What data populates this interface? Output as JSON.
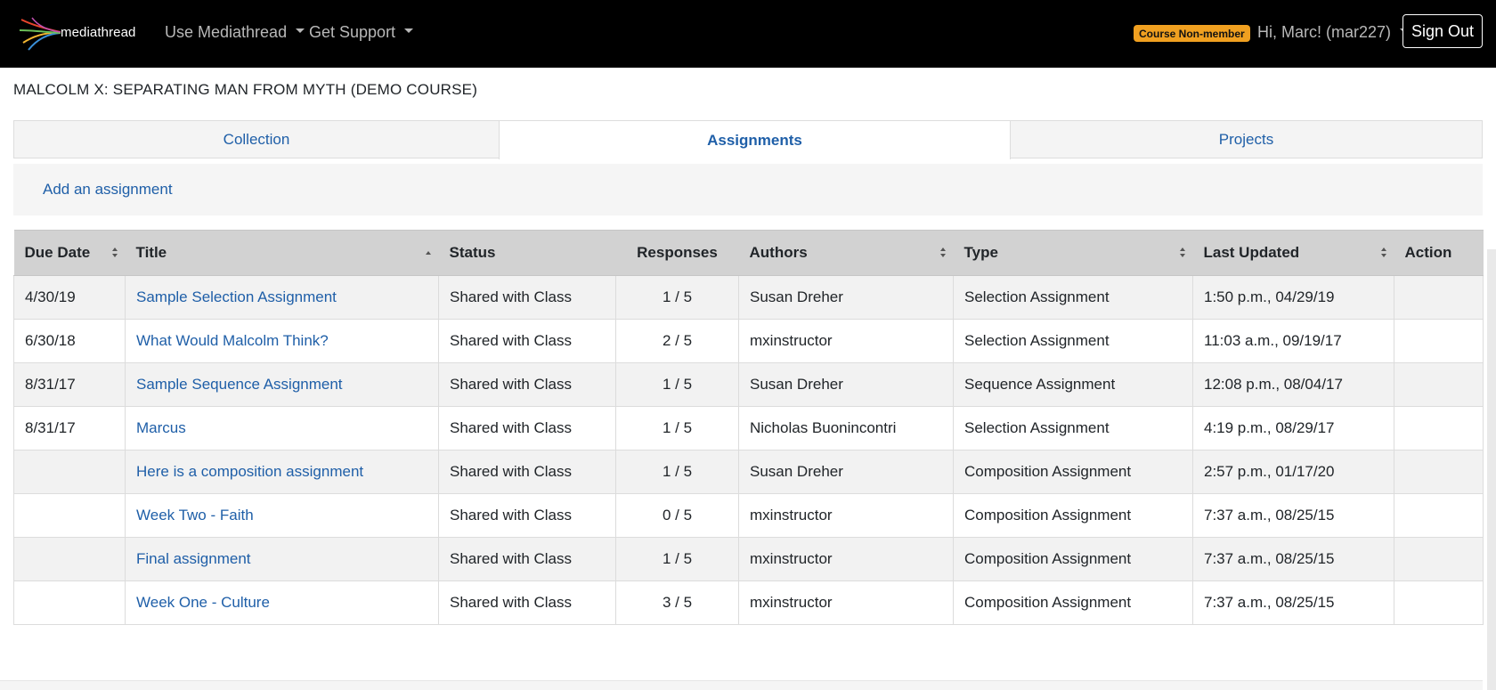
{
  "navbar": {
    "brand": "mediathread",
    "menu_use": "Use Mediathread",
    "menu_support": "Get Support",
    "badge": "Course Non-member",
    "user": "Hi, Marc! (mar227)",
    "sign_out": "Sign Out"
  },
  "course_title": "MALCOLM X: SEPARATING MAN FROM MYTH (DEMO COURSE)",
  "tabs": [
    {
      "label": "Collection"
    },
    {
      "label": "Assignments"
    },
    {
      "label": "Projects"
    }
  ],
  "add_assignment": "Add an assignment",
  "table": {
    "headers": {
      "due_date": "Due Date",
      "title": "Title",
      "status": "Status",
      "responses": "Responses",
      "authors": "Authors",
      "type": "Type",
      "last_updated": "Last Updated",
      "action": "Action"
    },
    "rows": [
      {
        "due": "4/30/19",
        "title": "Sample Selection Assignment",
        "status": "Shared with Class",
        "responses": "1 / 5",
        "author": "Susan Dreher",
        "type": "Selection Assignment",
        "updated": "1:50 p.m., 04/29/19"
      },
      {
        "due": "6/30/18",
        "title": "What Would Malcolm Think?",
        "status": "Shared with Class",
        "responses": "2 / 5",
        "author": "mxinstructor",
        "type": "Selection Assignment",
        "updated": "11:03 a.m., 09/19/17"
      },
      {
        "due": "8/31/17",
        "title": "Sample Sequence Assignment",
        "status": "Shared with Class",
        "responses": "1 / 5",
        "author": "Susan Dreher",
        "type": "Sequence Assignment",
        "updated": "12:08 p.m., 08/04/17"
      },
      {
        "due": "8/31/17",
        "title": "Marcus",
        "status": "Shared with Class",
        "responses": "1 / 5",
        "author": "Nicholas Buonincontri",
        "type": "Selection Assignment",
        "updated": "4:19 p.m., 08/29/17"
      },
      {
        "due": "",
        "title": "Here is a composition assignment",
        "status": "Shared with Class",
        "responses": "1 / 5",
        "author": "Susan Dreher",
        "type": "Composition Assignment",
        "updated": "2:57 p.m., 01/17/20"
      },
      {
        "due": "",
        "title": "Week Two - Faith",
        "status": "Shared with Class",
        "responses": "0 / 5",
        "author": "mxinstructor",
        "type": "Composition Assignment",
        "updated": "7:37 a.m., 08/25/15"
      },
      {
        "due": "",
        "title": "Final assignment",
        "status": "Shared with Class",
        "responses": "1 / 5",
        "author": "mxinstructor",
        "type": "Composition Assignment",
        "updated": "7:37 a.m., 08/25/15"
      },
      {
        "due": "",
        "title": "Week One - Culture",
        "status": "Shared with Class",
        "responses": "3 / 5",
        "author": "mxinstructor",
        "type": "Composition Assignment",
        "updated": "7:37 a.m., 08/25/15"
      }
    ]
  },
  "colors": {
    "navbar_bg": "#000000",
    "link": "#1f5fa8",
    "badge_bg": "#f0a020",
    "header_bg": "#d2d2d2"
  },
  "icons": [
    "mediathread-logo-icon",
    "caret-down-icon",
    "sort-both-icon",
    "sort-up-icon"
  ]
}
